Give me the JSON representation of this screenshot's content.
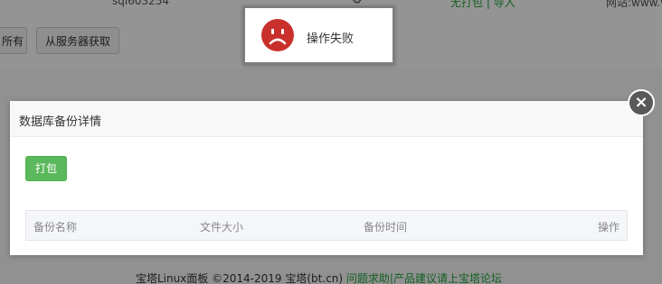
{
  "background": {
    "top_row": {
      "db_name": "sql603254",
      "actions_link": "无打包 | 导入",
      "website_text": "网站:www.w"
    },
    "buttons": {
      "partial_button": "所有",
      "get_from_server_button": "从服务器获取"
    },
    "footer": {
      "left_text": "宝塔Linux面板 ©2014-2019 宝塔(bt.cn)",
      "link_text": "问题求助|产品建议请上宝塔论坛"
    }
  },
  "toast": {
    "icon": "sad-face-icon",
    "message": "操作失败",
    "icon_color": "#c9302c"
  },
  "dialog": {
    "title": "数据库备份详情",
    "close_icon": "close-icon",
    "pack_button": "打包",
    "table": {
      "columns": [
        "备份名称",
        "文件大小",
        "备份时间",
        "操作"
      ],
      "rows": []
    }
  },
  "colors": {
    "primary_green": "#5cb85c",
    "link_green": "#20a53a",
    "close_button": "#595959"
  }
}
